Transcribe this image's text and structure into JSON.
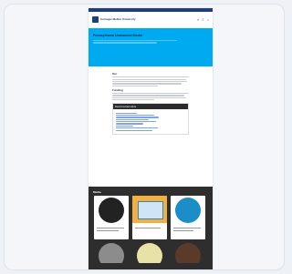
{
  "colors": {
    "brand_navy": "#1f3f7a",
    "hero_blue": "#00aaf0",
    "dark_band": "#2e2e2e",
    "link_blue": "#1c57c4"
  },
  "utility_bar": {
    "label": ""
  },
  "header": {
    "logo_text": "Carnegie Mellon University",
    "icons": [
      "search-icon",
      "menu-icon",
      "user-icon"
    ]
  },
  "hero": {
    "title": "Pennsylvania Unmanned Medal",
    "subtitle": ""
  },
  "content": {
    "sections": [
      {
        "title": "Our",
        "lines": 7
      },
      {
        "title": "Funding",
        "lines": 5
      }
    ],
    "toc": {
      "heading": "Recommended article",
      "items": [
        "",
        "",
        "",
        "",
        "",
        "",
        "",
        "",
        "",
        ""
      ]
    }
  },
  "media": {
    "title": "Media",
    "cards": [
      {
        "caption": ""
      },
      {
        "caption": ""
      },
      {
        "caption": ""
      }
    ]
  }
}
